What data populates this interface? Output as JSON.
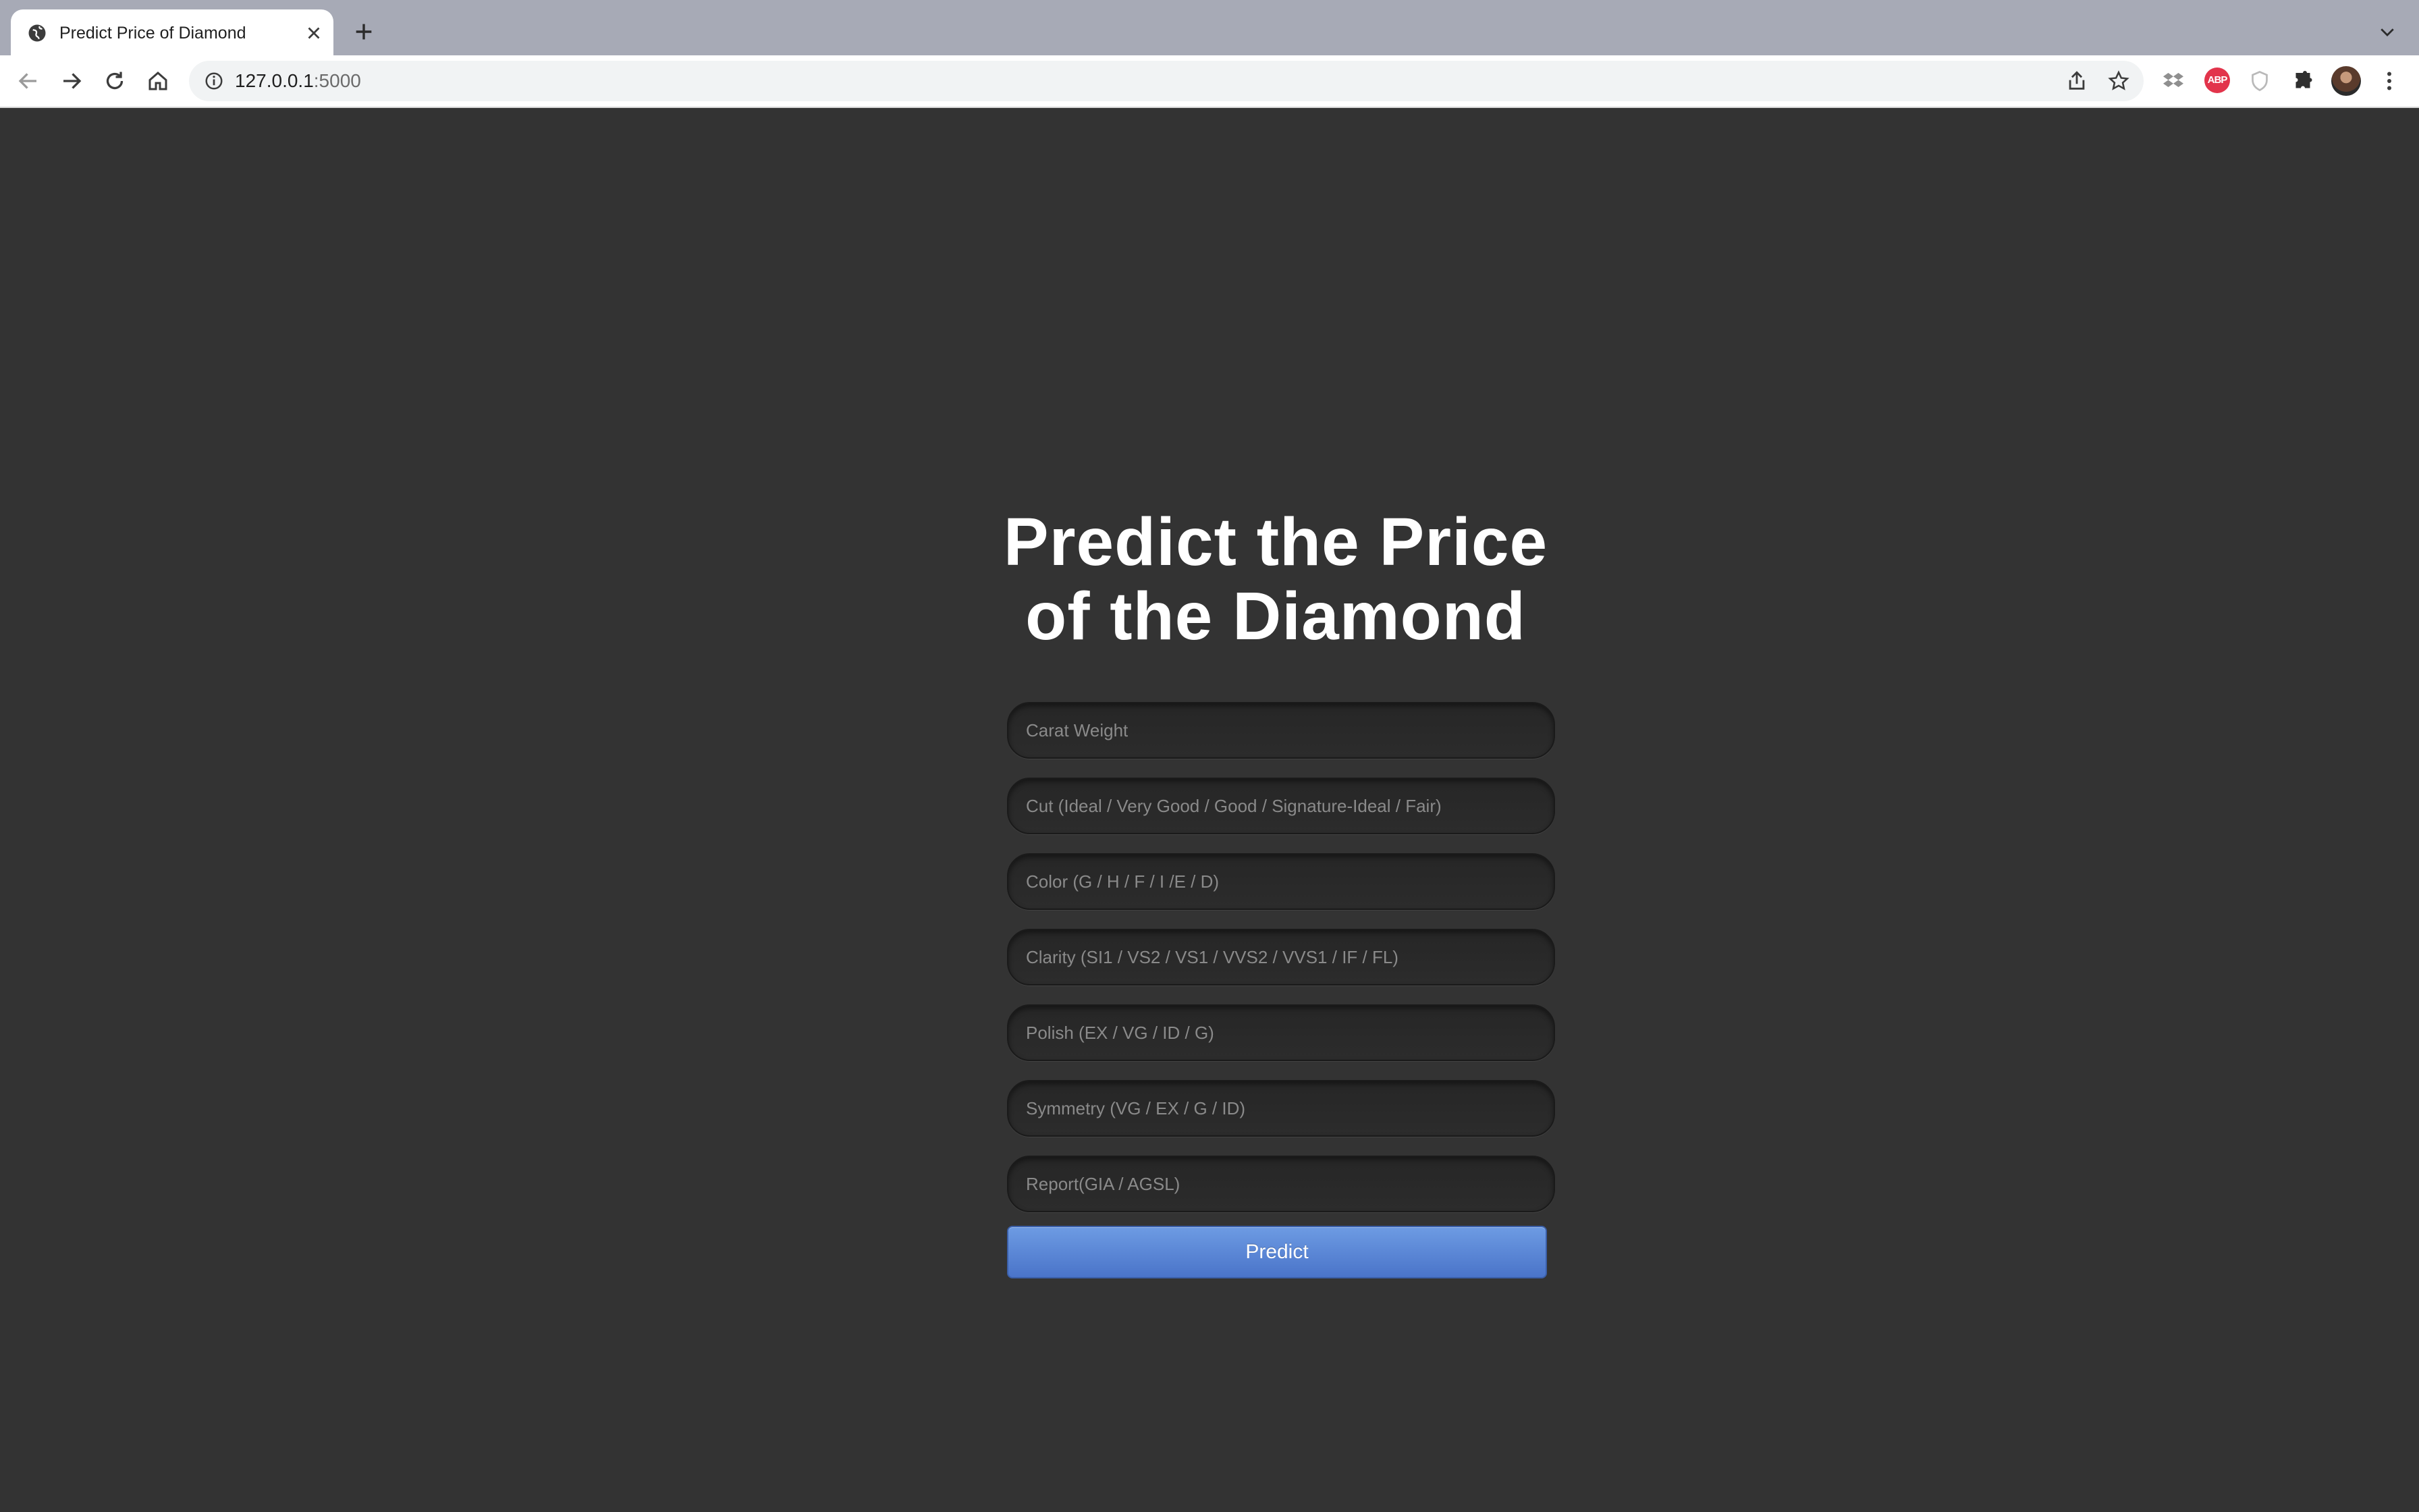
{
  "browser": {
    "tab": {
      "title": "Predict Price of Diamond"
    },
    "url": {
      "host": "127.0.0.1",
      "port": ":5000"
    },
    "extensions": {
      "abp_label": "ABP"
    }
  },
  "page": {
    "heading_line1": "Predict the Price",
    "heading_line2": "of the Diamond",
    "fields": [
      {
        "placeholder": "Carat Weight"
      },
      {
        "placeholder": "Cut (Ideal / Very Good / Good / Signature-Ideal / Fair)"
      },
      {
        "placeholder": "Color (G / H / F / I /E / D)"
      },
      {
        "placeholder": "Clarity (SI1 / VS2 / VS1 / VVS2 / VVS1 / IF / FL)"
      },
      {
        "placeholder": "Polish (EX / VG / ID / G)"
      },
      {
        "placeholder": "Symmetry (VG / EX / G / ID)"
      },
      {
        "placeholder": "Report(GIA / AGSL)"
      }
    ],
    "predict_label": "Predict"
  },
  "colors": {
    "page_background": "#333333",
    "button_blue": "#5b86d6",
    "heading": "#ffffff"
  }
}
